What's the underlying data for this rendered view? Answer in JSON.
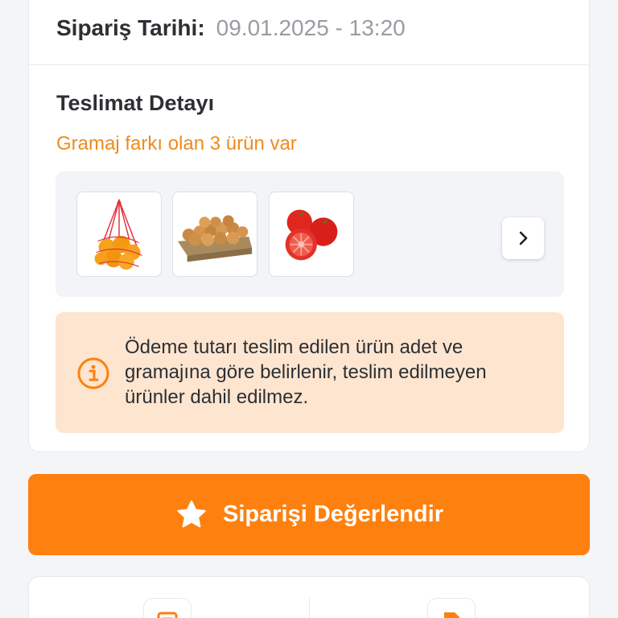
{
  "order": {
    "date_label": "Sipariş Tarihi:",
    "date_value": "09.01.2025 - 13:20"
  },
  "delivery": {
    "title": "Teslimat Detayı",
    "weight_difference_note": "Gramaj farkı olan 3 ürün var",
    "products": [
      {
        "name": "oranges-in-net",
        "icon": "orange-net-image"
      },
      {
        "name": "onions-crate",
        "icon": "onion-crate-image"
      },
      {
        "name": "tomatoes",
        "icon": "tomato-image"
      }
    ],
    "next_icon": "chevron-right-icon"
  },
  "info": {
    "icon": "info-icon",
    "text": "Ödeme tutarı teslim edilen ürün adet ve gramajına göre belirlenir, teslim edilmeyen ürünler dahil edilmez."
  },
  "actions": {
    "rate_label": "Siparişi Değerlendir",
    "rate_icon": "star-icon"
  },
  "colors": {
    "accent": "#fe800f",
    "note": "#f08a1c",
    "info_bg": "#fde5d0",
    "text": "#2d2f33",
    "muted": "#9a9ca3"
  }
}
